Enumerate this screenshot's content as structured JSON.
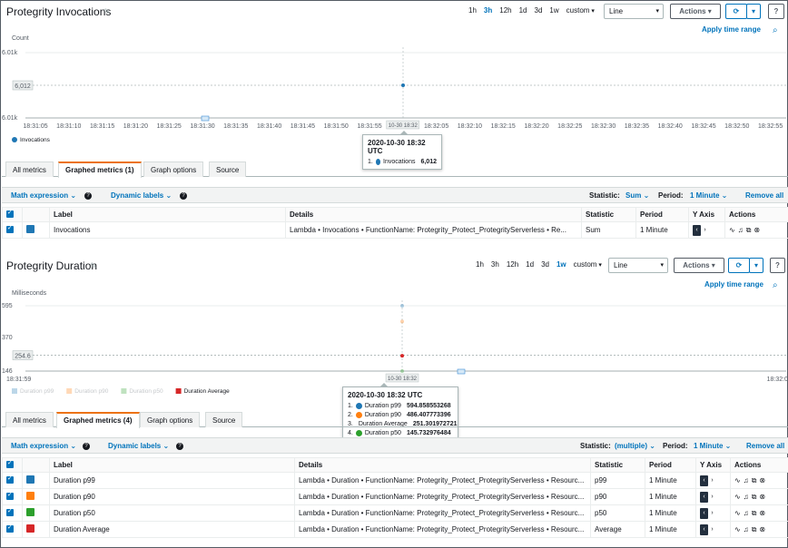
{
  "panel1": {
    "title": "Protegrity Invocations",
    "ranges": [
      "1h",
      "3h",
      "12h",
      "1d",
      "3d",
      "1w",
      "custom"
    ],
    "active_range": "3h",
    "view": "Line",
    "actions": "Actions",
    "apply_time_range": "Apply time range",
    "tabs": [
      "All metrics",
      "Graphed metrics (1)",
      "Graph options",
      "Source"
    ],
    "math_expression": "Math expression",
    "dynamic_labels": "Dynamic labels",
    "statistic_label": "Statistic:",
    "statistic_value": "Sum",
    "period_label": "Period:",
    "period_value": "1 Minute",
    "remove_all": "Remove all",
    "columns": [
      "Label",
      "Details",
      "Statistic",
      "Period",
      "Y Axis",
      "Actions"
    ],
    "rows": [
      {
        "label": "Invocations",
        "color": "#1f77b4",
        "details": "Lambda • Invocations • FunctionName: Protegrity_Protect_ProtegrityServerless • Re...",
        "statistic": "Sum",
        "period": "1 Minute"
      }
    ],
    "tooltip": {
      "header": "2020-10-30 18:32 UTC",
      "items": [
        {
          "n": "1.",
          "name": "Invocations",
          "value": "6,012",
          "color": "#1f77b4"
        }
      ]
    }
  },
  "panel2": {
    "title": "Protegrity Duration",
    "ranges": [
      "1h",
      "3h",
      "12h",
      "1d",
      "3d",
      "1w",
      "custom"
    ],
    "active_range": "1w",
    "view": "Line",
    "actions": "Actions",
    "apply_time_range": "Apply time range",
    "tabs": [
      "All metrics",
      "Graphed metrics (4)",
      "Graph options",
      "Source"
    ],
    "math_expression": "Math expression",
    "dynamic_labels": "Dynamic labels",
    "statistic_label": "Statistic:",
    "statistic_value": "(multiple)",
    "period_label": "Period:",
    "period_value": "1 Minute",
    "remove_all": "Remove all",
    "columns": [
      "Label",
      "Details",
      "Statistic",
      "Period",
      "Y Axis",
      "Actions"
    ],
    "rows": [
      {
        "label": "Duration p99",
        "color": "#1f77b4",
        "details": "Lambda • Duration • FunctionName: Protegrity_Protect_ProtegrityServerless • Resourc...",
        "statistic": "p99",
        "period": "1 Minute"
      },
      {
        "label": "Duration p90",
        "color": "#ff7f0e",
        "details": "Lambda • Duration • FunctionName: Protegrity_Protect_ProtegrityServerless • Resourc...",
        "statistic": "p90",
        "period": "1 Minute"
      },
      {
        "label": "Duration p50",
        "color": "#2ca02c",
        "details": "Lambda • Duration • FunctionName: Protegrity_Protect_ProtegrityServerless • Resourc...",
        "statistic": "p50",
        "period": "1 Minute"
      },
      {
        "label": "Duration Average",
        "color": "#d62728",
        "details": "Lambda • Duration • FunctionName: Protegrity_Protect_ProtegrityServerless • Resourc...",
        "statistic": "Average",
        "period": "1 Minute"
      }
    ],
    "tooltip": {
      "header": "2020-10-30 18:32 UTC",
      "items": [
        {
          "n": "1.",
          "name": "Duration p99",
          "value": "594.858553268",
          "color": "#1f77b4"
        },
        {
          "n": "2.",
          "name": "Duration p90",
          "value": "486.407773396",
          "color": "#ff7f0e"
        },
        {
          "n": "3.",
          "name": "Duration Average",
          "value": "251.301972721",
          "color": "#d62728"
        },
        {
          "n": "4.",
          "name": "Duration p50",
          "value": "145.732976484",
          "color": "#2ca02c"
        }
      ]
    }
  },
  "chart_data": [
    {
      "type": "line",
      "title": "Protegrity Invocations",
      "ylabel": "Count",
      "yticks": [
        "6.01k",
        "6.01k"
      ],
      "ylim": [
        6010,
        6014
      ],
      "ref_line_label": "6,012",
      "ref_line_value": 6012,
      "xticks": [
        "18:31:05",
        "18:31:10",
        "18:31:15",
        "18:31:20",
        "18:31:25",
        "18:31:30",
        "18:31:35",
        "18:31:40",
        "18:31:45",
        "18:31:50",
        "18:31:55",
        "10-30 18:32",
        "18:32:05",
        "18:32:10",
        "18:32:15",
        "18:32:20",
        "18:32:25",
        "18:32:30",
        "18:32:35",
        "18:32:40",
        "18:32:45",
        "18:32:50",
        "18:32:55"
      ],
      "series": [
        {
          "name": "Invocations",
          "color": "#1f77b4",
          "points": [
            {
              "x": "18:32",
              "y": 6012
            }
          ]
        }
      ],
      "legend": "bottom-left"
    },
    {
      "type": "line",
      "title": "Protegrity Duration",
      "ylabel": "Milliseconds",
      "yticks": [
        "595",
        "370",
        "146"
      ],
      "ylim": [
        146,
        595
      ],
      "ref_line_label": "254.6",
      "ref_line_value": 254.6,
      "xticks": [
        "18:31:59",
        "10-30 18:32",
        "18:32:0"
      ],
      "series": [
        {
          "name": "Duration p99",
          "color": "#1f77b4",
          "points": [
            {
              "x": "18:32",
              "y": 594.858553268
            }
          ]
        },
        {
          "name": "Duration p90",
          "color": "#ff7f0e",
          "points": [
            {
              "x": "18:32",
              "y": 486.407773396
            }
          ]
        },
        {
          "name": "Duration p50",
          "color": "#2ca02c",
          "points": [
            {
              "x": "18:32",
              "y": 145.732976484
            }
          ]
        },
        {
          "name": "Duration Average",
          "color": "#d62728",
          "points": [
            {
              "x": "18:32",
              "y": 251.301972721
            }
          ]
        }
      ],
      "legend": "bottom-left"
    }
  ]
}
